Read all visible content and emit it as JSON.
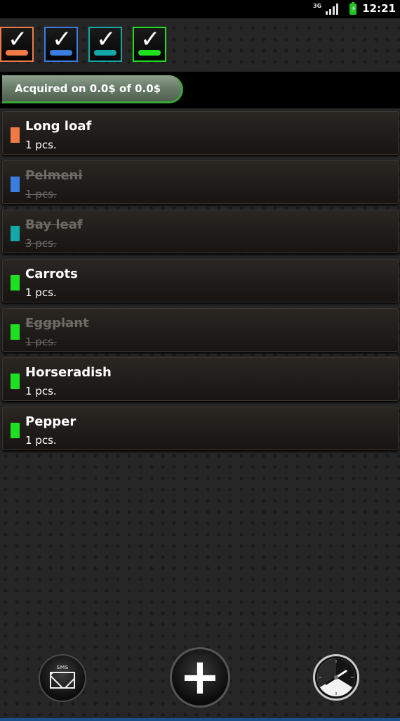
{
  "status_bar": {
    "data_icon_text": "3G",
    "time": "12:21"
  },
  "filters": [
    {
      "color": "#f07a45",
      "checked": true
    },
    {
      "color": "#3a7de0",
      "checked": true
    },
    {
      "color": "#14a7a7",
      "checked": true
    },
    {
      "color": "#1fe01f",
      "checked": true
    }
  ],
  "summary": {
    "text": "Acquired on 0.0$ of 0.0$"
  },
  "items": [
    {
      "name": "Long loaf",
      "qty": "1 pcs.",
      "color": "#f07a45",
      "done": false
    },
    {
      "name": "Pelmeni",
      "qty": "1 pcs.",
      "color": "#3a7de0",
      "done": true
    },
    {
      "name": "Bay leaf",
      "qty": "3 pcs.",
      "color": "#14a7a7",
      "done": true
    },
    {
      "name": "Carrots",
      "qty": "1 pcs.",
      "color": "#1fe01f",
      "done": false
    },
    {
      "name": "Eggplant",
      "qty": "1 pcs.",
      "color": "#1fe01f",
      "done": true
    },
    {
      "name": "Horseradish",
      "qty": "1 pcs.",
      "color": "#1fe01f",
      "done": false
    },
    {
      "name": "Pepper",
      "qty": "1 pcs.",
      "color": "#1fe01f",
      "done": false
    }
  ],
  "bottom_bar": {
    "sms_label": "SMS",
    "sms_icon": "envelope-icon",
    "add_icon": "plus-icon",
    "reminder_icon": "clock-icon"
  }
}
